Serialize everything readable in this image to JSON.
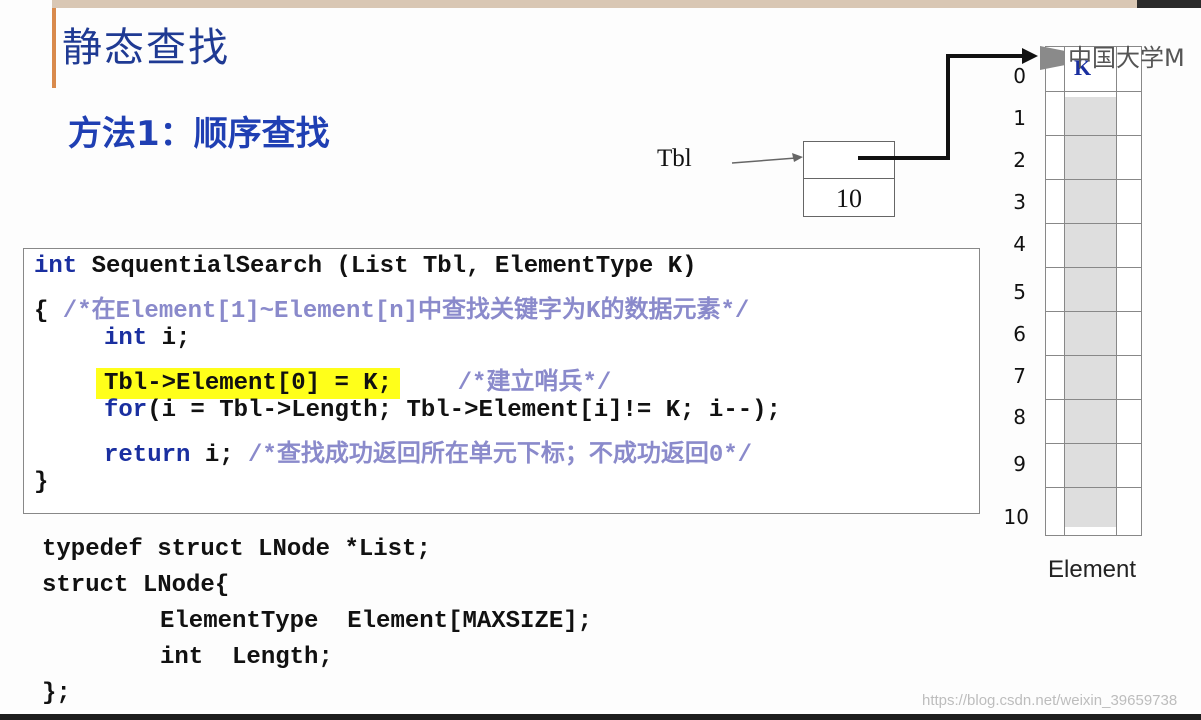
{
  "slide": {
    "title": "静态查找",
    "subtitle": "方法1：顺序查找"
  },
  "diagram": {
    "tbl_label": "Tbl",
    "tbl_length_value": "10",
    "array_key_cell": "K",
    "array_indices": [
      "0",
      "1",
      "2",
      "3",
      "4",
      "5",
      "6",
      "7",
      "8",
      "9",
      "10"
    ],
    "array_label": "Element"
  },
  "code": {
    "line1": {
      "kw": "int",
      "text": " SequentialSearch (List Tbl, ElementType K)"
    },
    "line2": {
      "brace": "{",
      "comment": " /*在Element[1]~Element[n]中查找关键字为K的数据元素*/"
    },
    "line3": {
      "kw": "int",
      "text": " i;"
    },
    "line4": {
      "code": "Tbl->Element[0] = K;",
      "comment": "/*建立哨兵*/"
    },
    "line5": {
      "kw": "for",
      "text": "(i = Tbl->Length; Tbl->Element[i]!= K; i--);"
    },
    "line6": {
      "kw": "return",
      "text": " i; ",
      "comment": "/*查找成功返回所在单元下标；不成功返回0*/"
    },
    "line7": {
      "brace": "}"
    }
  },
  "struct_code": [
    "typedef struct LNode *List;",
    "struct LNode{",
    "ElementType  Element[MAXSIZE];",
    "int  Length;",
    "};"
  ],
  "watermark": {
    "logo_text": "中国大学M",
    "url": "https://blog.csdn.net/weixin_39659738"
  },
  "colors": {
    "title": "#1f3a93",
    "keyword": "#1a2fa0",
    "comment": "#8a8acb",
    "highlight": "#ffff1a",
    "accent_bar": "#d98a4c"
  }
}
